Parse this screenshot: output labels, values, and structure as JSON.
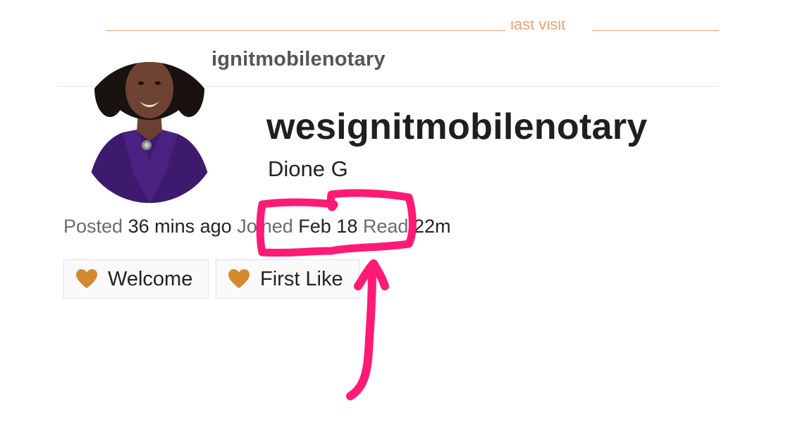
{
  "background_stream": {
    "last_visit_label": "last visit",
    "partial_username": "ignitmobilenotary"
  },
  "user_card": {
    "username": "wesignitmobilenotary",
    "full_name": "Dione G",
    "meta": {
      "posted_label": "Posted",
      "posted_value": "36 mins ago",
      "joined_label": "Joined",
      "joined_value": "Feb 18",
      "read_label": "Read",
      "read_value": "22m"
    },
    "badges": [
      {
        "label": "Welcome",
        "icon": "heart-icon"
      },
      {
        "label": "First Like",
        "icon": "heart-icon"
      }
    ]
  },
  "colors": {
    "accent_line": "#f0a070",
    "badge_heart": "#d5892f",
    "annotation": "#ff1a75"
  }
}
